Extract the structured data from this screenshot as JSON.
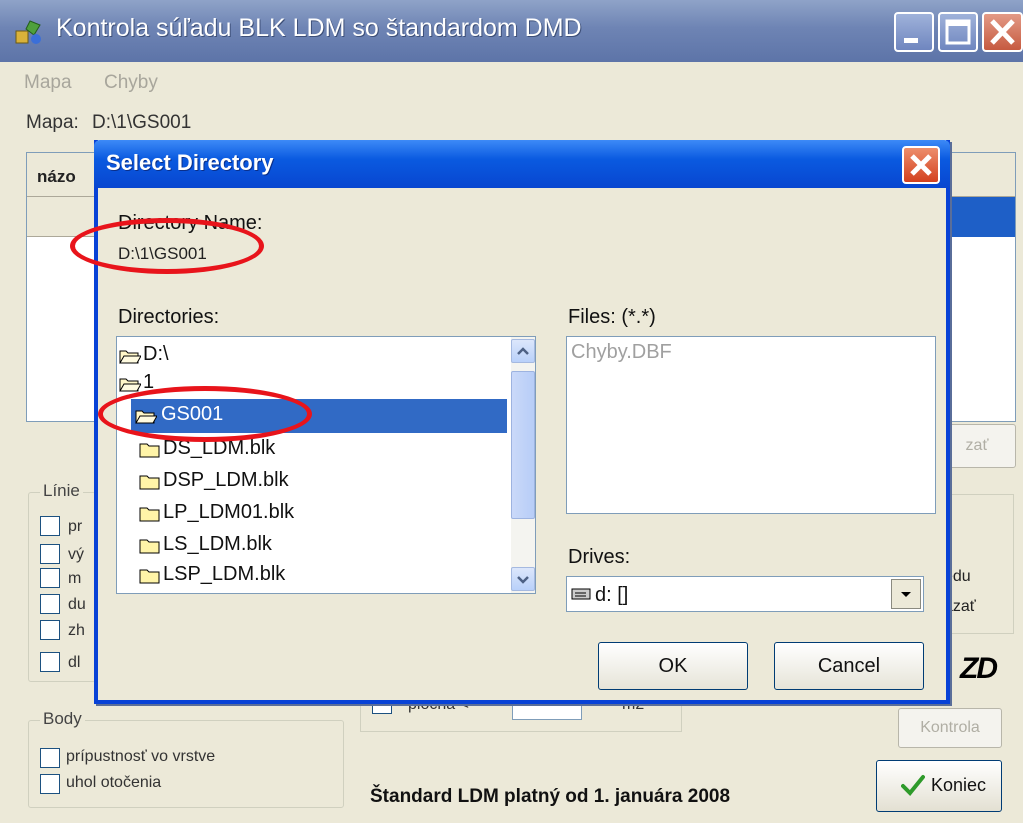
{
  "main_window": {
    "title": "Kontrola súľadu BLK LDM so štandardom DMD",
    "menu": [
      "Mapa",
      "Chyby"
    ],
    "map_label": "Mapa:",
    "map_path": "D:\\1\\GS001",
    "grid_header": "názo",
    "zobrazit_button": "zať",
    "linie_group": {
      "caption": "Línie",
      "items": [
        "pr",
        "vý",
        "m",
        "du",
        "zh",
        "dl"
      ]
    },
    "body_group": {
      "caption": "Body",
      "items": [
        "prípustnosť vo vrstve",
        "uhol otočenia"
      ]
    },
    "right_text_1": "edu",
    "right_text_2": "azať",
    "area_row": {
      "label": "plocha <",
      "unit": "m2"
    },
    "standard_text": "Štandard LDM platný od 1. januára 2008",
    "kontrola_button": "Kontrola",
    "koniec_button": "Koniec",
    "logo": "ZD"
  },
  "dialog": {
    "title": "Select Directory",
    "dirname_label": "Directory Name:",
    "dirname_value": "D:\\1\\GS001",
    "directories_label": "Directories:",
    "directories": [
      "D:\\",
      "1",
      "GS001",
      "DS_LDM.blk",
      "DSP_LDM.blk",
      "LP_LDM01.blk",
      "LS_LDM.blk",
      "LSP_LDM.blk"
    ],
    "selected_directory": "GS001",
    "files_label": "Files: (*.*)",
    "files": [
      "Chyby.DBF"
    ],
    "drives_label": "Drives:",
    "drives_value": "d: []",
    "ok_label": "OK",
    "cancel_label": "Cancel"
  },
  "annotation_color": "#e8141b",
  "colors": {
    "title_bar": "#0a5ae0",
    "selection": "#316ac5",
    "window_bg": "#ece9d8"
  }
}
